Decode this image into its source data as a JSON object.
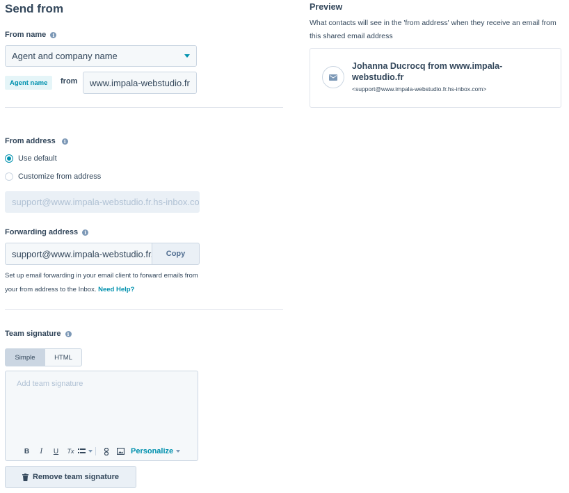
{
  "send_from": {
    "title": "Send from",
    "from_name_label": "From name",
    "from_name_select": "Agent and company name",
    "agent_token": "Agent name",
    "from_word": "from",
    "company_input_value": "www.impala-webstudio.fr"
  },
  "from_address": {
    "label": "From address",
    "options": [
      {
        "label": "Use default",
        "selected": true
      },
      {
        "label": "Customize from address",
        "selected": false
      }
    ],
    "disabled_value": "support@www.impala-webstudio.fr.hs-inbox.com"
  },
  "forwarding": {
    "label": "Forwarding address",
    "value": "support@www.impala-webstudio.fr.hs-inbox.com",
    "copy_label": "Copy",
    "help_text": "Set up email forwarding in your email client to forward emails from your from address to the Inbox.",
    "help_link": "Need Help?"
  },
  "signature": {
    "label": "Team signature",
    "tabs": [
      "Simple",
      "HTML"
    ],
    "placeholder": "Add team signature",
    "toolbar": {
      "bold": "B",
      "italic": "I",
      "underline": "U",
      "clear_format": "Tx",
      "personalize": "Personalize"
    },
    "remove_label": "Remove team signature"
  },
  "preview": {
    "title": "Preview",
    "description": "What contacts will see in the 'from address' when they receive an email from this shared email address",
    "sender_name": "Johanna Ducrocq from www.impala-webstudio.fr",
    "sender_email": "<support@www.impala-webstudio.fr.hs-inbox.com>"
  },
  "colors": {
    "accent": "#0091ae",
    "text": "#33475b",
    "border": "#cbd6e2",
    "field_bg": "#f5f8fa"
  },
  "icons": [
    "info-icon",
    "caret-down-icon",
    "bold-icon",
    "italic-icon",
    "underline-icon",
    "clear-format-icon",
    "list-icon",
    "link-icon",
    "image-icon",
    "trash-icon",
    "email-icon"
  ]
}
